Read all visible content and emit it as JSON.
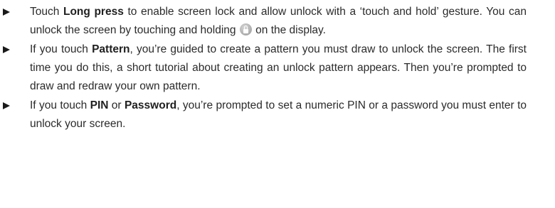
{
  "items": [
    {
      "t1": "Touch ",
      "b1": "Long press",
      "t2": " to enable screen lock and allow unlock with a ‘touch and hold’ gesture. You can unlock the screen by touching and holding ",
      "icon": "lock-icon",
      "t3": " on the display."
    },
    {
      "t1": "If you touch ",
      "b1": "Pattern",
      "t2": ", you’re guided to create a pattern you must draw to unlock the screen. The first time you do this, a short tutorial about creating an unlock pattern appears. Then you’re prompted to draw and redraw your own pattern."
    },
    {
      "t1": "If you touch ",
      "b1": "PIN",
      "t2": " or ",
      "b2": "Password",
      "t3": ", you’re prompted to set a numeric PIN or a password you must enter to unlock your screen."
    }
  ]
}
